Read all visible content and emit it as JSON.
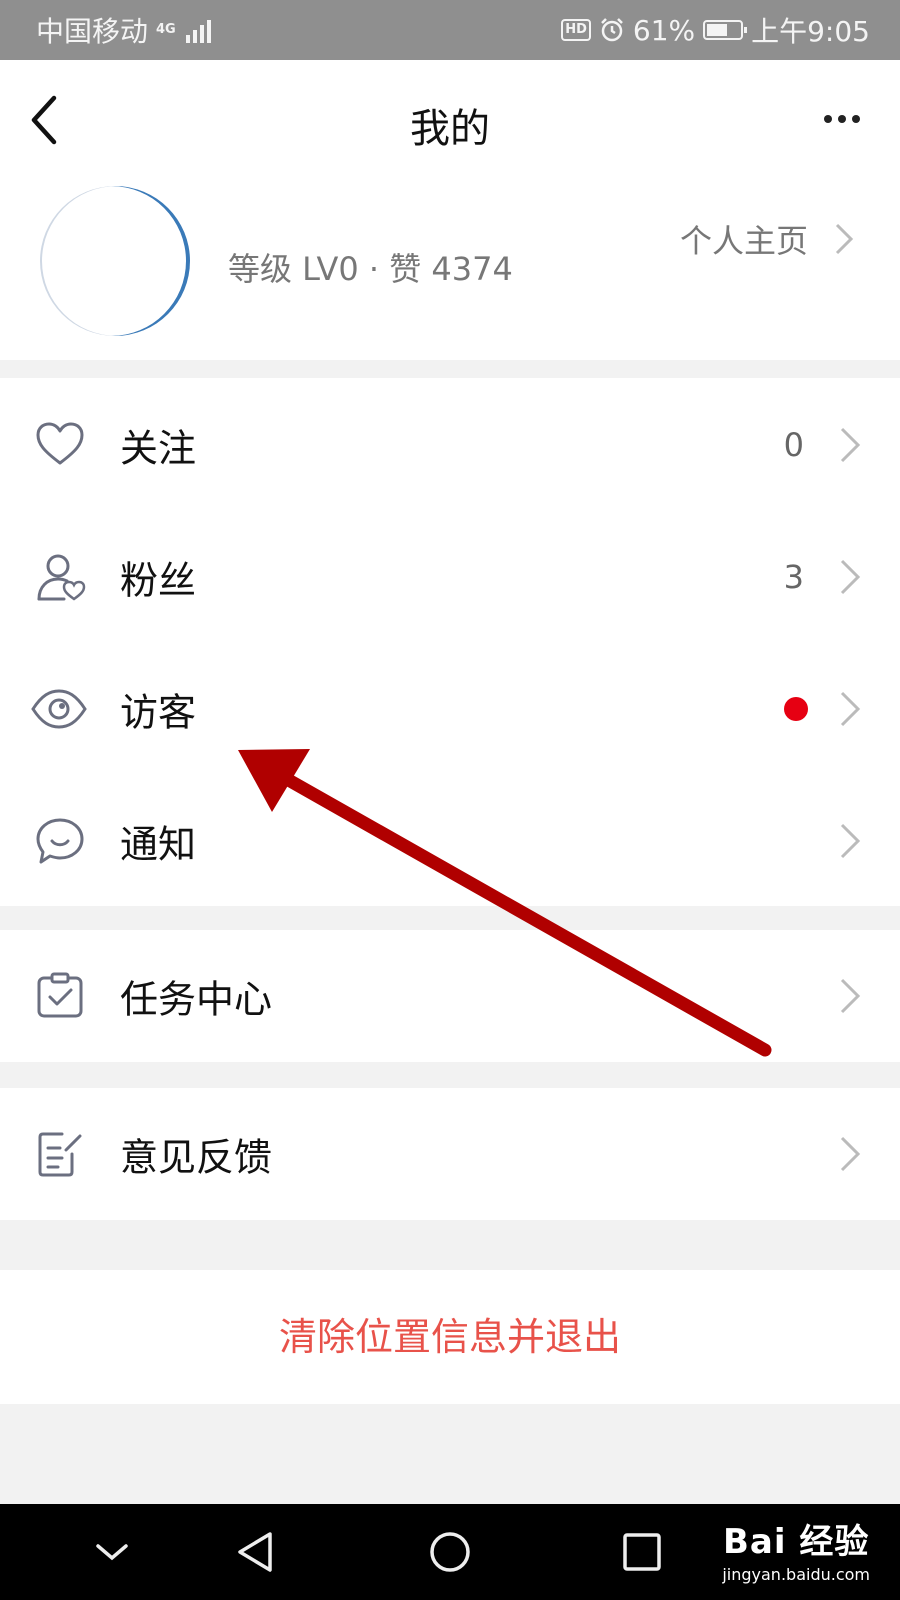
{
  "statusbar": {
    "carrier": "中国移动",
    "network": "4G",
    "hd": "HD",
    "battery_percent": "61%",
    "battery_level": 0.61,
    "time": "上午9:05"
  },
  "navbar": {
    "title": "我的"
  },
  "profile": {
    "stats": "等级 LV0 · 赞 4374",
    "homepage_label": "个人主页"
  },
  "menu": {
    "follow": {
      "label": "关注",
      "count": "0",
      "icon": "heart-icon"
    },
    "fans": {
      "label": "粉丝",
      "count": "3",
      "icon": "user-heart-icon"
    },
    "visitors": {
      "label": "访客",
      "icon": "eye-icon"
    },
    "notify": {
      "label": "通知",
      "icon": "chat-bubble-icon"
    },
    "tasks": {
      "label": "任务中心",
      "icon": "clipboard-check-icon"
    },
    "feedback": {
      "label": "意见反馈",
      "icon": "edit-note-icon"
    }
  },
  "logout_label": "清除位置信息并退出",
  "watermark": {
    "brand": "Bai 经验",
    "url": "jingyan.baidu.com"
  },
  "colors": {
    "accent_red": "#e60012",
    "logout_red": "#e8524a",
    "annotation_arrow": "#b00000"
  }
}
